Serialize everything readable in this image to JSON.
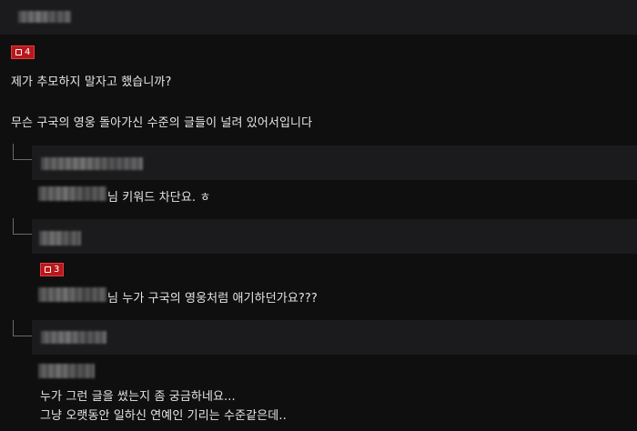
{
  "comment_main": {
    "vote_count": "4",
    "line1": "제가 추모하지 말자고 했습니까?",
    "line2": "무슨 구국의 영웅 돌아가신 수준의 글들이 널려 있어서입니다"
  },
  "reply1": {
    "text": "님 키워드 차단요. ㅎ"
  },
  "reply2": {
    "vote_count": "3",
    "text": "님 누가 구국의 영웅처럼 애기하던가요???"
  },
  "reply3": {
    "line1": "누가 그런 글을 썼는지 좀 궁금하네요...",
    "line2": "그냥 오랫동안 일하신 연예인 기리는 수준같은데.."
  },
  "colors": {
    "background": "#0f0f10",
    "header_bar": "#1b1b1d",
    "badge": "#b8171c"
  }
}
